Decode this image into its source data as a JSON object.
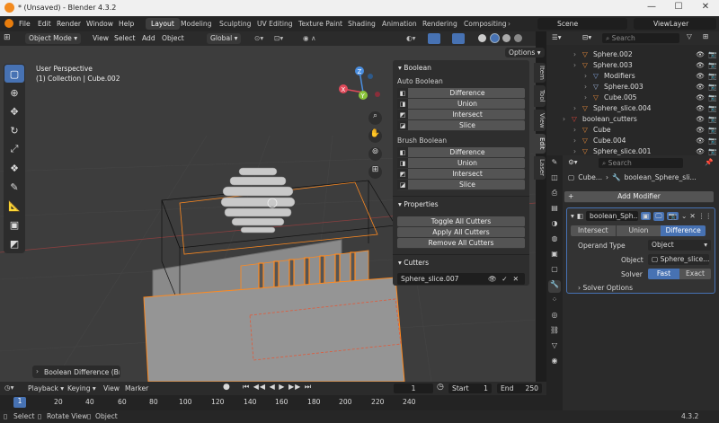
{
  "titlebar": {
    "title": "* (Unsaved) - Blender 4.3.2",
    "minimize": "—",
    "maximize": "☐",
    "close": "✕"
  },
  "menu": {
    "file": "File",
    "edit": "Edit",
    "render": "Render",
    "window": "Window",
    "help": "Help"
  },
  "workspaces": [
    "Layout",
    "Modeling",
    "Sculpting",
    "UV Editing",
    "Texture Paint",
    "Shading",
    "Animation",
    "Rendering",
    "Compositing"
  ],
  "scene": {
    "name": "Scene",
    "view_layer": "ViewLayer"
  },
  "viewport_header": {
    "mode": "Object Mode",
    "view": "View",
    "select": "Select",
    "add": "Add",
    "object": "Object",
    "orientation": "Global",
    "options": "Options"
  },
  "viewport": {
    "perspective": "User Perspective",
    "collection": "(1) Collection | Cube.002",
    "last_op": "Boolean Difference (Brus"
  },
  "gizmo": {
    "x": "X",
    "y": "Y",
    "z": "Z"
  },
  "npanel": {
    "title": "Boolean",
    "auto_label": "Auto Boolean",
    "auto": [
      "Difference",
      "Union",
      "Intersect",
      "Slice"
    ],
    "brush_label": "Brush Boolean",
    "brush": [
      "Difference",
      "Union",
      "Intersect",
      "Slice"
    ],
    "properties_title": "Properties",
    "properties": [
      "Toggle All Cutters",
      "Apply All Cutters",
      "Remove All Cutters"
    ],
    "cutters_title": "Cutters",
    "cutter": "Sphere_slice.007"
  },
  "side_tabs": [
    "Item",
    "Tool",
    "View",
    "Edit",
    "Laser"
  ],
  "outliner": {
    "search_placeholder": "Search",
    "items": [
      {
        "label": "Sphere.002",
        "color": "#e88a3a",
        "indent": 1
      },
      {
        "label": "Sphere.003",
        "color": "#e88a3a",
        "indent": 1
      },
      {
        "label": "Modifiers",
        "color": "#7fa0d8",
        "indent": 2
      },
      {
        "label": "Sphere.003",
        "color": "#9fb4d8",
        "indent": 2
      },
      {
        "label": "Cube.005",
        "color": "#e88a3a",
        "indent": 2
      },
      {
        "label": "Sphere_slice.004",
        "color": "#e88a3a",
        "indent": 1
      },
      {
        "label": "boolean_cutters",
        "color": "#e0453a",
        "indent": 0
      },
      {
        "label": "Cube",
        "color": "#e88a3a",
        "indent": 1
      },
      {
        "label": "Cube.004",
        "color": "#e88a3a",
        "indent": 1
      },
      {
        "label": "Sphere_slice.001",
        "color": "#e88a3a",
        "indent": 1
      }
    ]
  },
  "properties": {
    "search_placeholder": "Search",
    "breadcrumb_obj": "Cube...",
    "breadcrumb_mod": "boolean_Sphere_sli...",
    "add_modifier": "Add Modifier",
    "modifier_name": "boolean_Sph...",
    "ops": [
      "Intersect",
      "Union",
      "Difference"
    ],
    "operand_label": "Operand Type",
    "operand_value": "Object",
    "object_label": "Object",
    "object_value": "Sphere_slice...",
    "solver_label": "Solver",
    "solver_opts": [
      "Fast",
      "Exact"
    ],
    "solver_options": "Solver Options"
  },
  "timeline": {
    "playback": "Playback",
    "keying": "Keying",
    "view": "View",
    "marker": "Marker",
    "current_frame": "1",
    "start_label": "Start",
    "start": "1",
    "end_label": "End",
    "end": "250",
    "ticks": [
      "1",
      "20",
      "40",
      "60",
      "80",
      "100",
      "120",
      "140",
      "160",
      "180",
      "200",
      "220",
      "240"
    ]
  },
  "status": {
    "select": "Select",
    "rotate": "Rotate View",
    "object": "Object",
    "version": "4.3.2"
  },
  "colors": {
    "accent": "#4772b3",
    "selected_orange": "#ff8a20",
    "bg": "#3d3d3d"
  }
}
